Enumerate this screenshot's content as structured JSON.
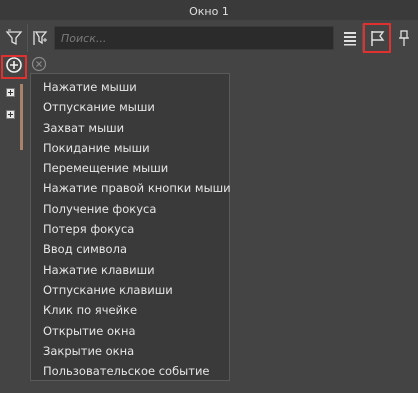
{
  "window": {
    "title": "Окно 1"
  },
  "toolbar": {
    "search_placeholder": "Поиск...",
    "buttons": [
      "filter-icon",
      "filter-settings-icon",
      "list-icon",
      "flag-icon",
      "pin-icon"
    ]
  },
  "colors": {
    "highlight": "#e0302f",
    "menu_bg": "#3a3a3a",
    "window_bg": "#444444"
  },
  "menu": {
    "items": [
      "Нажатие мыши",
      "Отпускание мыши",
      "Захват мыши",
      "Покидание мыши",
      "Перемещение мыши",
      "Нажатие правой кнопки мыши",
      "Получение фокуса",
      "Потеря фокуса",
      "Ввод символа",
      "Нажатие клавиши",
      "Отпускание клавиши",
      "Клик по ячейке",
      "Открытие окна",
      "Закрытие окна",
      "Пользовательское событие"
    ]
  }
}
